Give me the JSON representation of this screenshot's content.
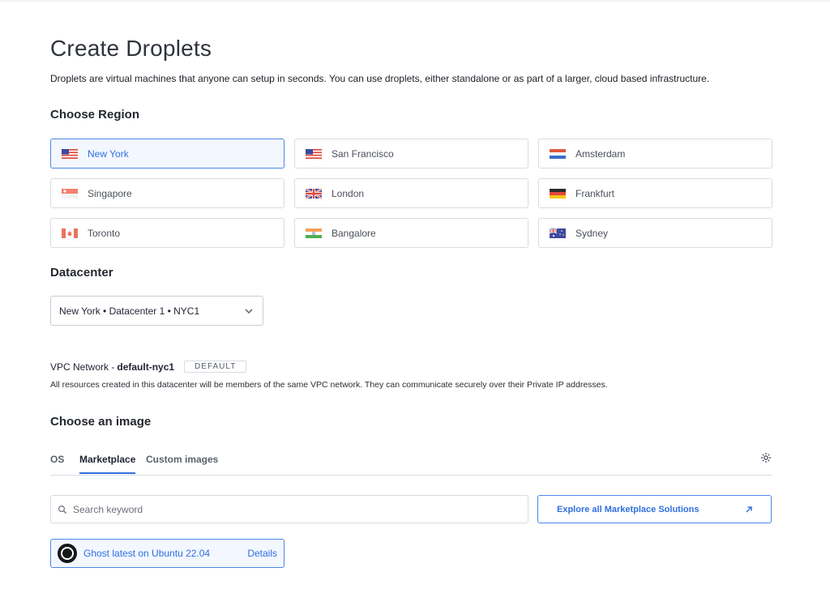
{
  "page": {
    "title": "Create Droplets",
    "subtitle": "Droplets are virtual machines that anyone can setup in seconds. You can use droplets, either standalone or as part of a larger, cloud based infrastructure."
  },
  "region": {
    "heading": "Choose Region",
    "selected": "New York",
    "items": [
      {
        "label": "New York",
        "flag": "us-flag-icon"
      },
      {
        "label": "San Francisco",
        "flag": "us-flag-icon"
      },
      {
        "label": "Amsterdam",
        "flag": "netherlands-flag-icon"
      },
      {
        "label": "Singapore",
        "flag": "singapore-flag-icon"
      },
      {
        "label": "London",
        "flag": "uk-flag-icon"
      },
      {
        "label": "Frankfurt",
        "flag": "germany-flag-icon"
      },
      {
        "label": "Toronto",
        "flag": "canada-flag-icon"
      },
      {
        "label": "Bangalore",
        "flag": "india-flag-icon"
      },
      {
        "label": "Sydney",
        "flag": "australia-flag-icon"
      }
    ]
  },
  "datacenter": {
    "heading": "Datacenter",
    "value": "New York • Datacenter 1 • NYC1"
  },
  "vpc": {
    "label": "VPC Network -",
    "name": "default-nyc1",
    "badge": "DEFAULT",
    "description": "All resources created in this datacenter will be members of the same VPC network. They can communicate securely over their Private IP addresses."
  },
  "image": {
    "heading": "Choose an image",
    "tabs": [
      {
        "label": "OS"
      },
      {
        "label": "Marketplace"
      },
      {
        "label": "Custom images"
      }
    ],
    "active_tab": "Marketplace",
    "search_placeholder": "Search keyword",
    "search_value": "",
    "explore_label": "Explore all Marketplace Solutions",
    "selected_app": {
      "name": "Ghost latest on Ubuntu 22.04",
      "details_label": "Details"
    }
  },
  "colors": {
    "accent": "#2f6fe0",
    "selected_border": "#4b87e8",
    "selected_bg": "#f3f7ff"
  }
}
